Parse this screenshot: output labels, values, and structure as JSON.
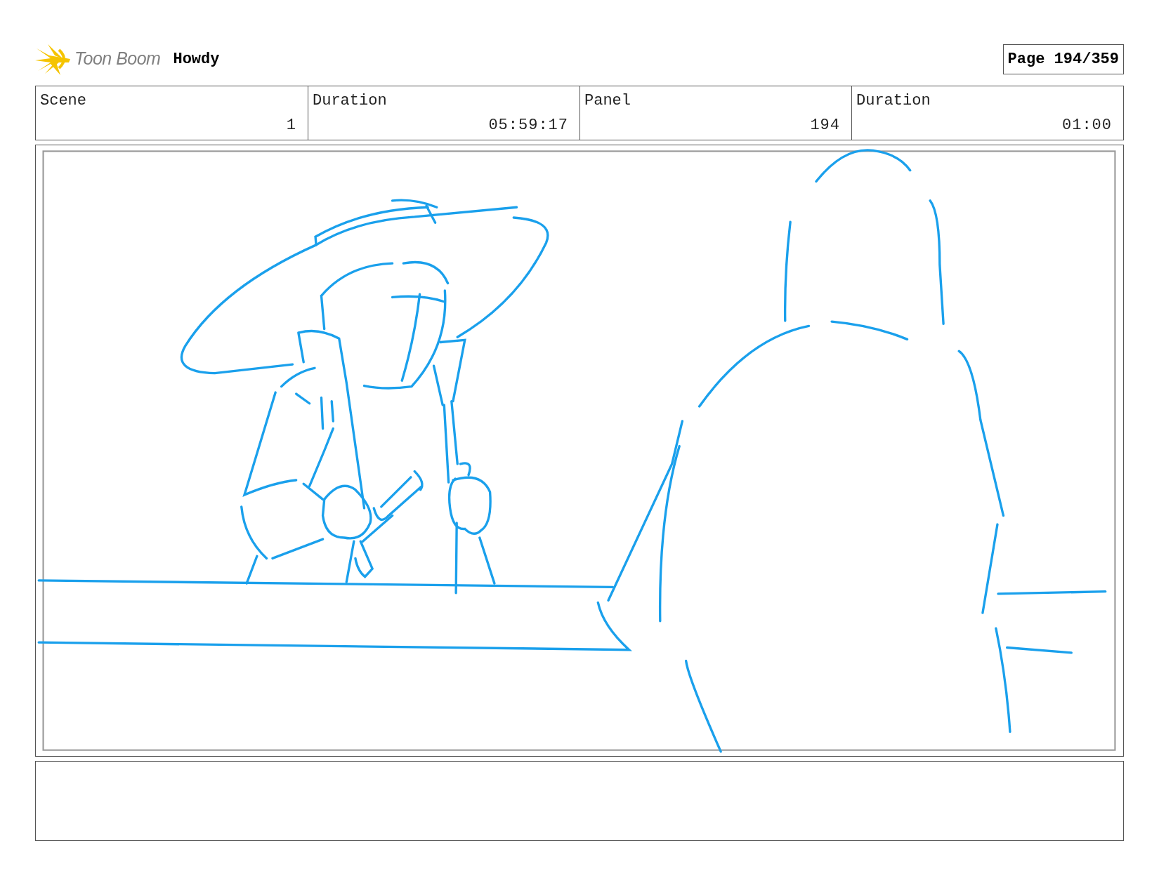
{
  "header": {
    "logo_text": "Toon Boom",
    "project": "Howdy",
    "page": "Page 194/359"
  },
  "fields": [
    {
      "label": "Scene",
      "value": "1"
    },
    {
      "label": "Duration",
      "value": "05:59:17"
    },
    {
      "label": "Panel",
      "value": "194"
    },
    {
      "label": "Duration",
      "value": "01:00"
    }
  ]
}
